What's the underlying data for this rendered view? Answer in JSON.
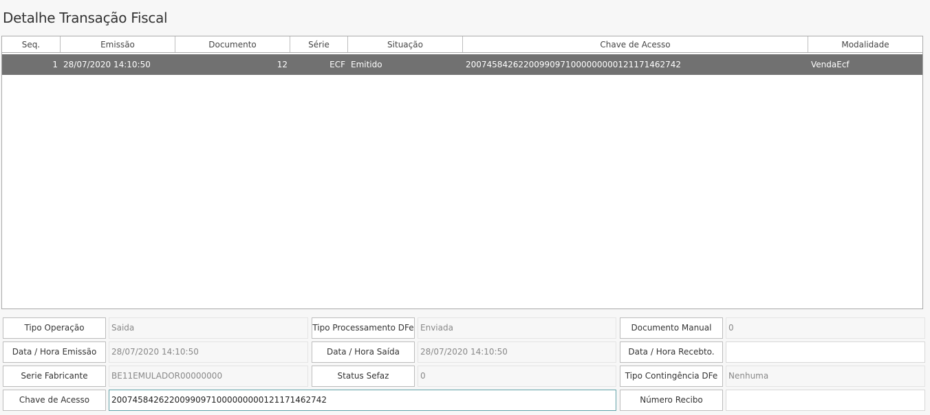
{
  "page": {
    "title": "Detalhe Transação Fiscal"
  },
  "grid": {
    "columns": [
      "Seq.",
      "Emissão",
      "Documento",
      "Série",
      "Situação",
      "Chave de Acesso",
      "Modalidade"
    ],
    "rows": [
      {
        "seq": "1",
        "emissao": "28/07/2020 14:10:50",
        "documento": "12",
        "serie": "ECF",
        "situacao": "Emitido",
        "chave": "20074584262200990971000000000121171462742",
        "modalidade": "VendaEcf"
      }
    ]
  },
  "form": {
    "tipo_operacao": {
      "label": "Tipo Operação",
      "value": "Saida"
    },
    "data_hora_emissao": {
      "label": "Data / Hora Emissão",
      "value": "28/07/2020 14:10:50"
    },
    "serie_fabricante": {
      "label": "Serie Fabricante",
      "value": "BE11EMULADOR00000000"
    },
    "chave_acesso": {
      "label": "Chave de Acesso",
      "value": "20074584262200990971000000000121171462742"
    },
    "tipo_processamento": {
      "label": "Tipo Processamento DFe",
      "value": "Enviada"
    },
    "data_hora_saida": {
      "label": "Data / Hora Saída",
      "value": "28/07/2020 14:10:50"
    },
    "status_sefaz": {
      "label": "Status Sefaz",
      "value": "0"
    },
    "documento_manual": {
      "label": "Documento Manual",
      "value": "0"
    },
    "data_hora_recebto": {
      "label": "Data / Hora Recebto.",
      "value": ""
    },
    "tipo_contingencia": {
      "label": "Tipo Contingência DFe",
      "value": "Nenhuma"
    },
    "numero_recibo": {
      "label": "Número Recibo",
      "value": ""
    }
  }
}
